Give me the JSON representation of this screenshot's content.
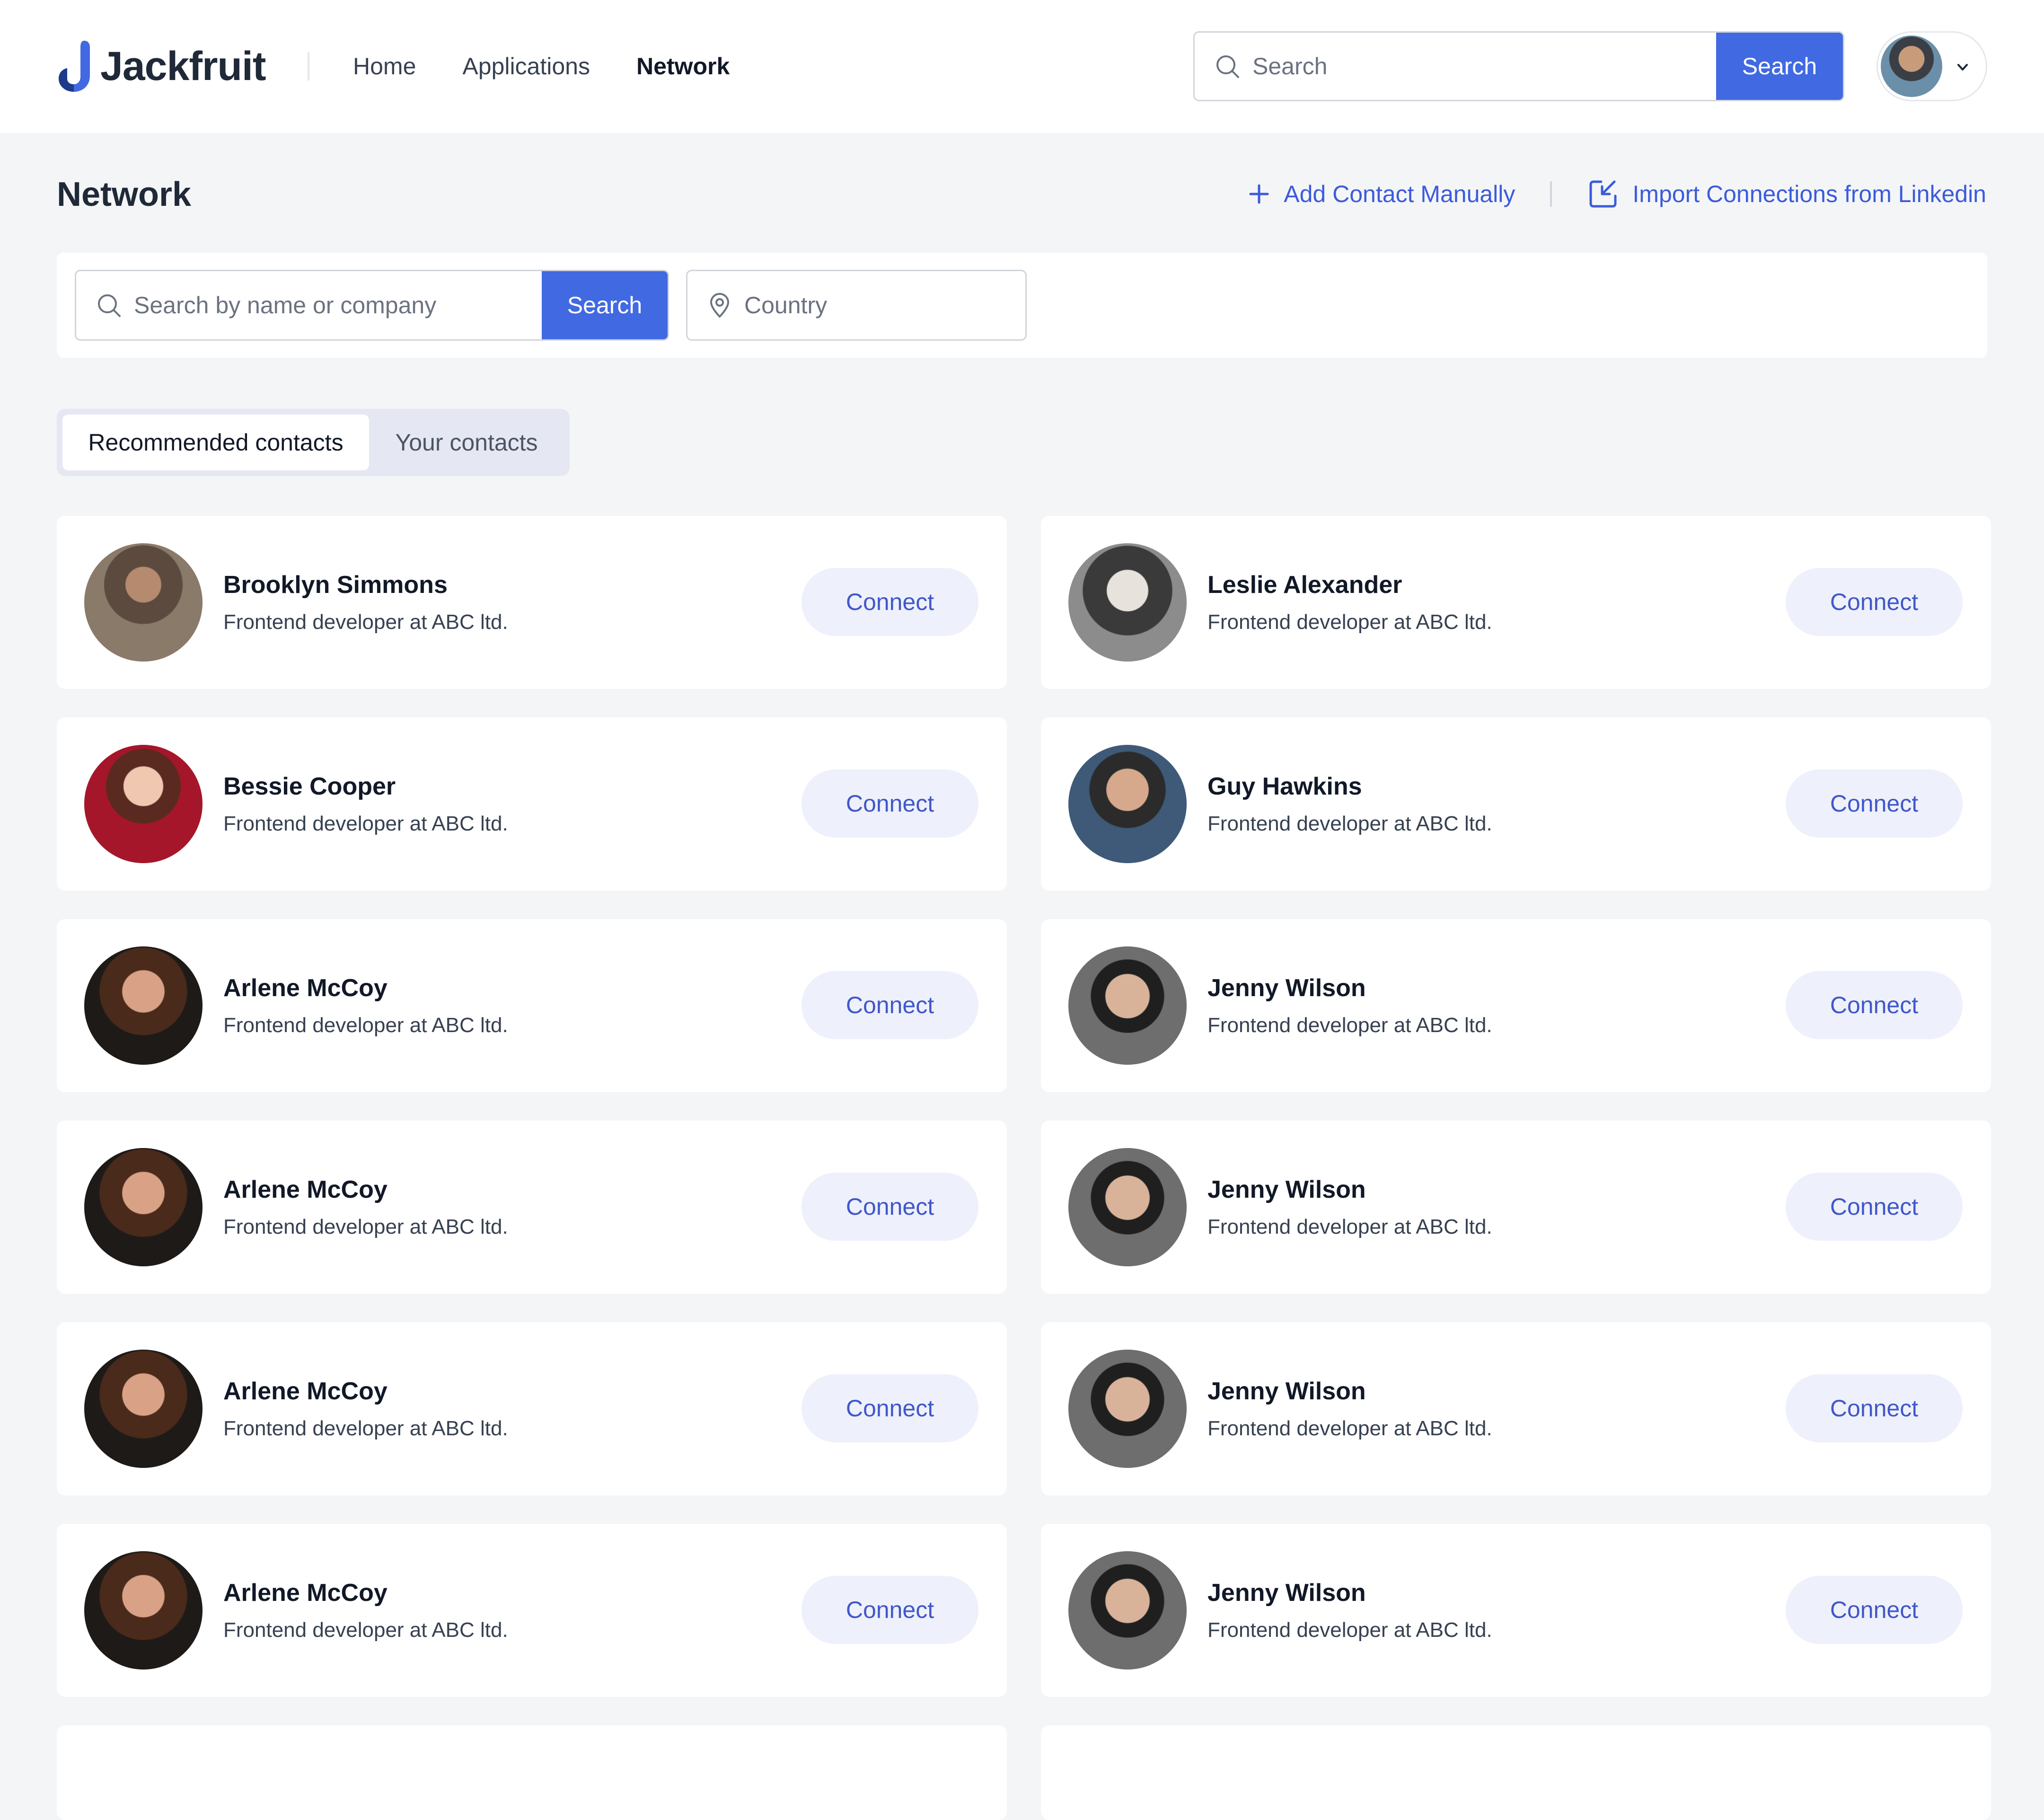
{
  "header": {
    "brand": "Jackfruit",
    "nav": [
      "Home",
      "Applications",
      "Network"
    ],
    "active_nav": "Network",
    "search": {
      "placeholder": "Search",
      "button": "Search"
    },
    "user": {
      "avatar_icon": "user-avatar",
      "menu_icon": "chevron-down-icon"
    }
  },
  "page": {
    "title": "Network",
    "actions": {
      "add": "Add Contact Manually",
      "import": "Import Connections from Linkedin"
    }
  },
  "filters": {
    "search_placeholder": "Search by name or company",
    "search_button": "Search",
    "country_placeholder": "Country"
  },
  "tabs": {
    "recommended": "Recommended contacts",
    "yours": "Your contacts"
  },
  "contacts": [
    {
      "name": "Brooklyn Simmons",
      "role": "Frontend developer at ABC ltd.",
      "action": "Connect"
    },
    {
      "name": "Leslie Alexander",
      "role": "Frontend developer at ABC ltd.",
      "action": "Connect"
    },
    {
      "name": "Bessie Cooper",
      "role": "Frontend developer at ABC ltd.",
      "action": "Connect"
    },
    {
      "name": "Guy Hawkins",
      "role": "Frontend developer at ABC ltd.",
      "action": "Connect"
    },
    {
      "name": "Arlene McCoy",
      "role": "Frontend developer at ABC ltd.",
      "action": "Connect"
    },
    {
      "name": "Jenny Wilson",
      "role": "Frontend developer at ABC ltd.",
      "action": "Connect"
    },
    {
      "name": "Arlene McCoy",
      "role": "Frontend developer at ABC ltd.",
      "action": "Connect"
    },
    {
      "name": "Jenny Wilson",
      "role": "Frontend developer at ABC ltd.",
      "action": "Connect"
    },
    {
      "name": "Arlene McCoy",
      "role": "Frontend developer at ABC ltd.",
      "action": "Connect"
    },
    {
      "name": "Jenny Wilson",
      "role": "Frontend developer at ABC ltd.",
      "action": "Connect"
    },
    {
      "name": "Arlene McCoy",
      "role": "Frontend developer at ABC ltd.",
      "action": "Connect"
    },
    {
      "name": "Jenny Wilson",
      "role": "Frontend developer at ABC ltd.",
      "action": "Connect"
    }
  ],
  "colors": {
    "accent": "#4169e1",
    "link": "#3b5bdb",
    "connect_bg": "#eef0fb",
    "page_bg": "#f4f5f7"
  }
}
